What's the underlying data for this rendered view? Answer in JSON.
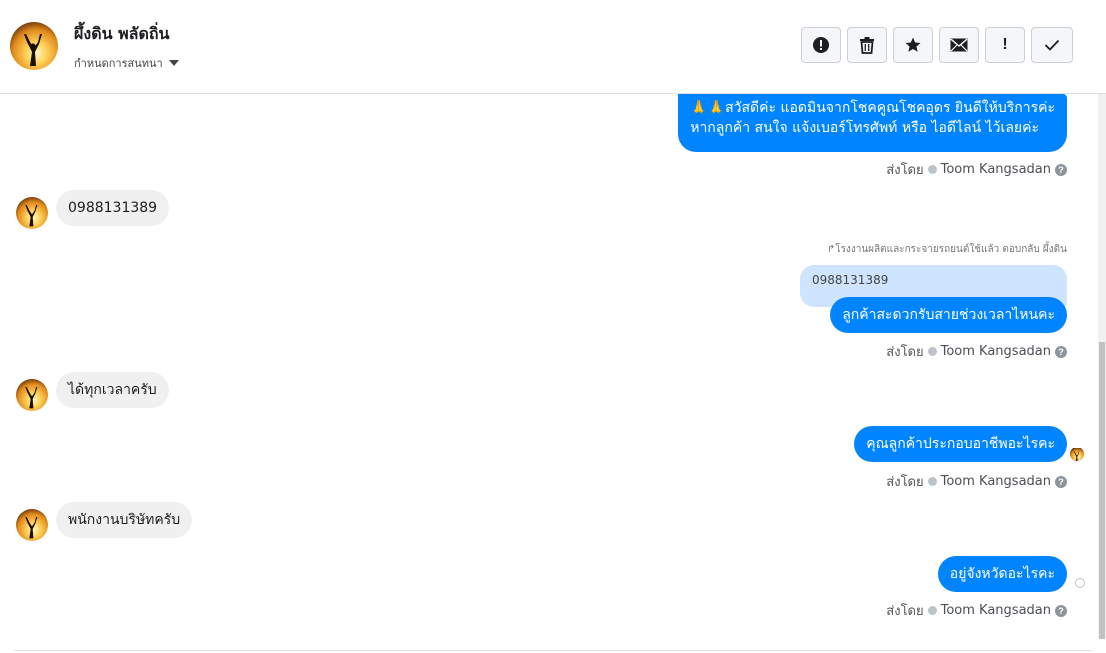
{
  "header": {
    "name": "ผึ้งดิน พลัดถิ่น",
    "subtitle": "กำหนดการสนทนา"
  },
  "toolbar": {
    "buttons": [
      {
        "icon": "alert-circle-icon",
        "label": "spam"
      },
      {
        "icon": "trash-icon",
        "label": "delete"
      },
      {
        "icon": "star-icon",
        "label": "star"
      },
      {
        "icon": "envelope-icon",
        "label": "mark-unread"
      },
      {
        "icon": "exclamation-icon",
        "label": "!"
      },
      {
        "icon": "checkmark-icon",
        "label": "done"
      }
    ]
  },
  "messages": {
    "m1": "🙏🙏สวัสดีค่ะ แอดมินจากโชคคูณโชคอุดร ยินดีให้บริการค่ะ",
    "m1b": "หากลูกค้า สนใจ แจ้งเบอร์โทรศัพท์ หรือ ไอดีไลน์  ไว้เลยค่ะ",
    "in1": "0988131389",
    "reply_note": "↱โรงงานผลิตและกระจายรถยนต์ใช้แล้ว ตอบกลับ ผึ้งดิน",
    "quoted": "0988131389",
    "m2": "ลูกค้าสะดวกรับสายช่วงเวลาไหนคะ",
    "in2": "ได้ทุกเวลาครับ",
    "m3": "คุณลูกค้าประกอบอาชีพอะไรคะ",
    "in3": "พนักงานบริษัทครับ",
    "m4": "อยู่จังหวัดอะไรคะ"
  },
  "sent_by": {
    "prefix": "ส่งโดย",
    "agent": "Toom Kangsadan",
    "help": "?"
  },
  "colors": {
    "outgoing": "#0084ff",
    "incoming": "#f1f0f0",
    "quoted": "#cfe4ff"
  }
}
